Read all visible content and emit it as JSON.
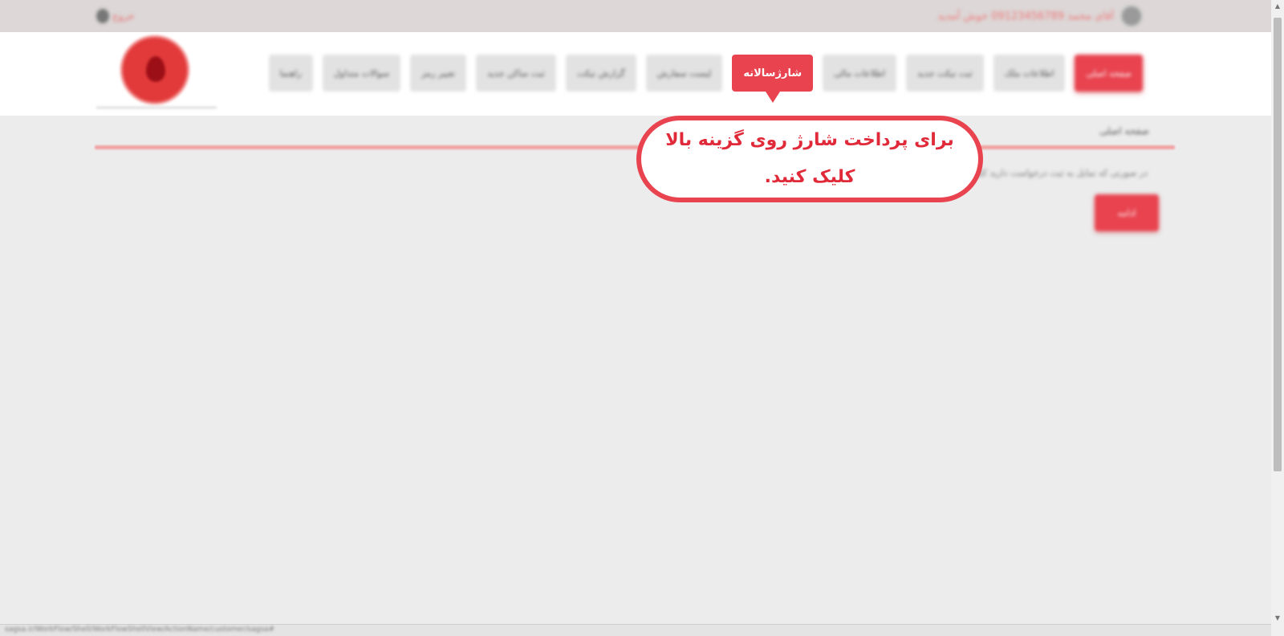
{
  "topbar": {
    "logout_label": "خروج",
    "user_text": "آقای محمد 09123456789 خوش آمدید"
  },
  "nav": {
    "items": [
      {
        "label": "صفحه اصلی"
      },
      {
        "label": "اطلاعات ملک"
      },
      {
        "label": "ثبت تیکت جدید"
      },
      {
        "label": "اطلاعات مالی"
      },
      {
        "label": "شارژسالانه"
      },
      {
        "label": "لیست سفارش"
      },
      {
        "label": "گزارش تیکت"
      },
      {
        "label": "ثبت ساکن جدید"
      },
      {
        "label": "تغییر رمز"
      },
      {
        "label": "سوالات متداول"
      },
      {
        "label": "راهنما"
      }
    ],
    "active_index": 4
  },
  "main": {
    "title": "صفحه اصلی",
    "description": "در صورتی که تمایل به ثبت درخواست دارید کلیک کنید",
    "button_label": "ادامه"
  },
  "callout": {
    "line1": "برای پرداخت شارژ روی گزینه بالا",
    "line2": "کلیک کنید."
  },
  "statusbar": {
    "url": "sagsa.ir/WorkFlow/Shell/WorkFlowShellView/ActionName/customer/sagsa#"
  },
  "colors": {
    "accent": "#e8434f",
    "callout_text": "#e02a3a",
    "background": "#ececec"
  }
}
